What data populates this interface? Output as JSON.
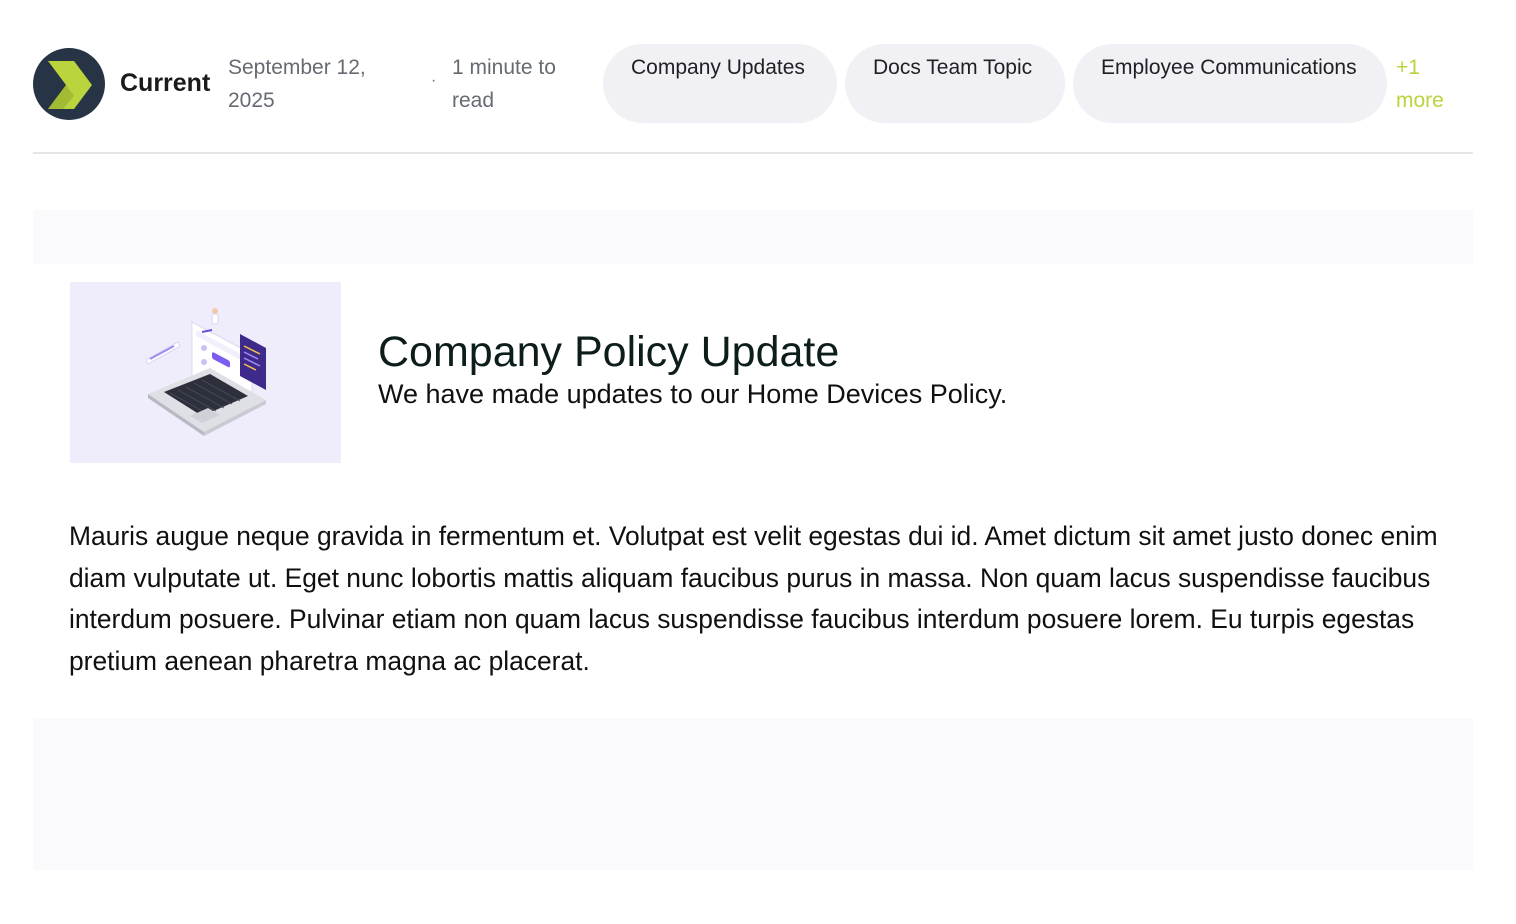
{
  "header": {
    "channel_name": "Current",
    "date": "September 12, 2025",
    "separator": "·",
    "read_time": "1 minute to read",
    "tags": [
      "Company Updates",
      "Docs Team Topic",
      "Employee Communications"
    ],
    "more_tags": "+1 more",
    "logo_icon": "current-logo-chevron-icon"
  },
  "article": {
    "title": "Company Policy Update",
    "subtitle": "We have made updates to our Home Devices Policy.",
    "image_icon": "laptop-illustration",
    "body": "Mauris augue neque gravida in fermentum et. Volutpat est velit egestas dui id. Amet dictum sit amet justo donec enim diam vulputate ut. Eget nunc lobortis mattis aliquam faucibus purus in massa. Non quam lacus suspendisse faucibus interdum posuere. Pulvinar etiam non quam lacus suspendisse faucibus interdum posuere lorem. Eu turpis egestas pretium aenean pharetra magna ac placerat."
  },
  "colors": {
    "logo_bg": "#263445",
    "logo_accent": "#b9d43d",
    "tag_bg": "#f0f0f5",
    "more_link": "#b9d43d",
    "hero_bg": "#efedfc",
    "title_text": "#0d1d1b",
    "meta_text": "#666b72"
  }
}
